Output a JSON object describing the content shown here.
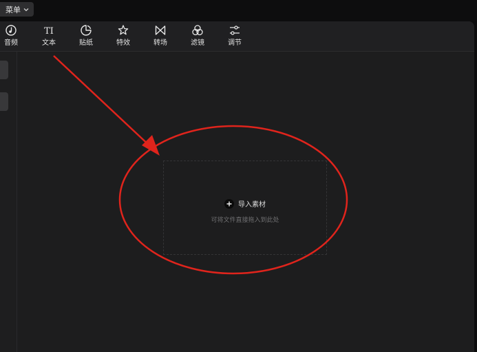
{
  "menu": {
    "label": "菜单",
    "icon": "chevron-down-icon"
  },
  "toolbar": {
    "tools": [
      {
        "label": "音频",
        "icon": "music-note-icon"
      },
      {
        "label": "文本",
        "icon": "text-icon",
        "glyph": "TI"
      },
      {
        "label": "贴纸",
        "icon": "sticker-icon"
      },
      {
        "label": "特效",
        "icon": "sparkle-star-icon"
      },
      {
        "label": "转场",
        "icon": "transition-bowtie-icon"
      },
      {
        "label": "滤镜",
        "icon": "filter-circles-icon"
      },
      {
        "label": "调节",
        "icon": "adjust-sliders-icon"
      }
    ]
  },
  "dropzone": {
    "import_label": "导入素材",
    "hint": "可将文件直接拖入到此处",
    "icon": "plus-icon"
  },
  "colors": {
    "annotation": "#e0241c",
    "panel": "#1e1e1f",
    "toolbar": "#202022"
  }
}
